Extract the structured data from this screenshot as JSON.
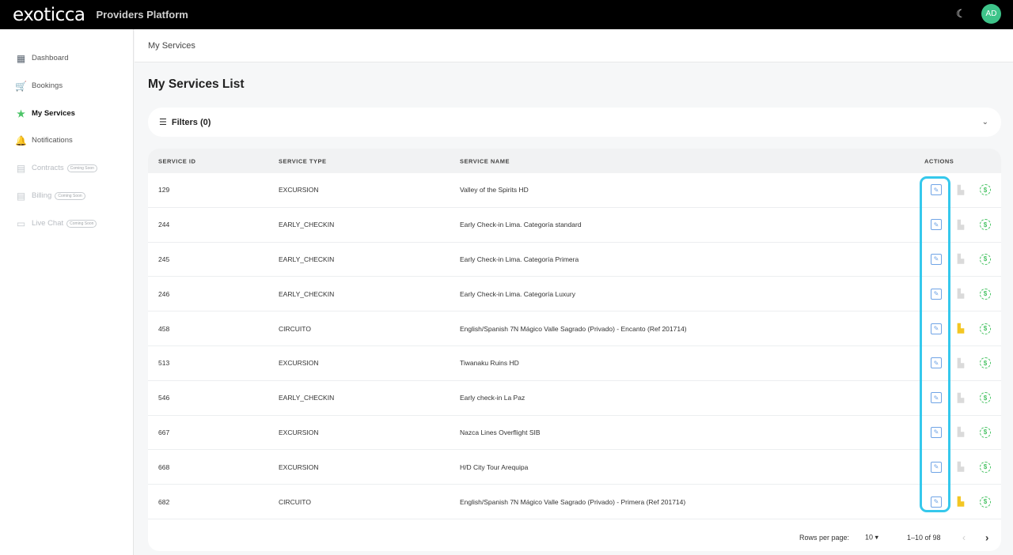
{
  "header": {
    "logo": "exoticca",
    "platform": "Providers Platform",
    "avatar": "AD"
  },
  "sidebar": {
    "items": [
      {
        "label": "Dashboard",
        "icon": "dashboard-icon",
        "glyph": "▦"
      },
      {
        "label": "Bookings",
        "icon": "cart-icon",
        "glyph": "🛒"
      },
      {
        "label": "My Services",
        "icon": "star-icon",
        "glyph": "★"
      },
      {
        "label": "Notifications",
        "icon": "bell-icon",
        "glyph": "🔔"
      },
      {
        "label": "Contracts",
        "icon": "document-icon",
        "glyph": "▤",
        "badge": "Coming Soon"
      },
      {
        "label": "Billing",
        "icon": "billing-icon",
        "glyph": "▤",
        "badge": "Coming Soon"
      },
      {
        "label": "Live Chat",
        "icon": "chat-icon",
        "glyph": "▭",
        "badge": "Coming Soon"
      }
    ]
  },
  "breadcrumb": "My Services",
  "title": "My Services List",
  "filters": {
    "label": "Filters (0)"
  },
  "table": {
    "columns": [
      "SERVICE ID",
      "SERVICE TYPE",
      "SERVICE NAME",
      "ACTIONS"
    ],
    "rows": [
      {
        "id": "129",
        "type": "EXCURSION",
        "name": "Valley of the Spirits HD",
        "building_active": false
      },
      {
        "id": "244",
        "type": "EARLY_CHECKIN",
        "name": "Early Check-in Lima. Categoría standard",
        "building_active": false
      },
      {
        "id": "245",
        "type": "EARLY_CHECKIN",
        "name": "Early Check-in Lima. Categoría Primera",
        "building_active": false
      },
      {
        "id": "246",
        "type": "EARLY_CHECKIN",
        "name": "Early Check-in Lima. Categoría Luxury",
        "building_active": false
      },
      {
        "id": "458",
        "type": "CIRCUITO",
        "name": "English/Spanish 7N Mágico Valle Sagrado (Privado) - Encanto (Ref 201714)",
        "building_active": true
      },
      {
        "id": "513",
        "type": "EXCURSION",
        "name": "Tiwanaku Ruins HD",
        "building_active": false
      },
      {
        "id": "546",
        "type": "EARLY_CHECKIN",
        "name": "Early check-in La Paz",
        "building_active": false
      },
      {
        "id": "667",
        "type": "EXCURSION",
        "name": "Nazca Lines Overflight SIB",
        "building_active": false
      },
      {
        "id": "668",
        "type": "EXCURSION",
        "name": "H/D City Tour Arequipa",
        "building_active": false
      },
      {
        "id": "682",
        "type": "CIRCUITO",
        "name": "English/Spanish 7N Mágico Valle Sagrado (Privado) - Primera (Ref 201714)",
        "building_active": true
      }
    ]
  },
  "pagination": {
    "rows_label": "Rows per page:",
    "rows_value": "10",
    "range": "1–10 of 98"
  },
  "colors": {
    "accent": "#3ec48a",
    "edit": "#6fa4e6",
    "money": "#4cc467",
    "building": "#f3c623",
    "highlight": "#35c8ec"
  }
}
